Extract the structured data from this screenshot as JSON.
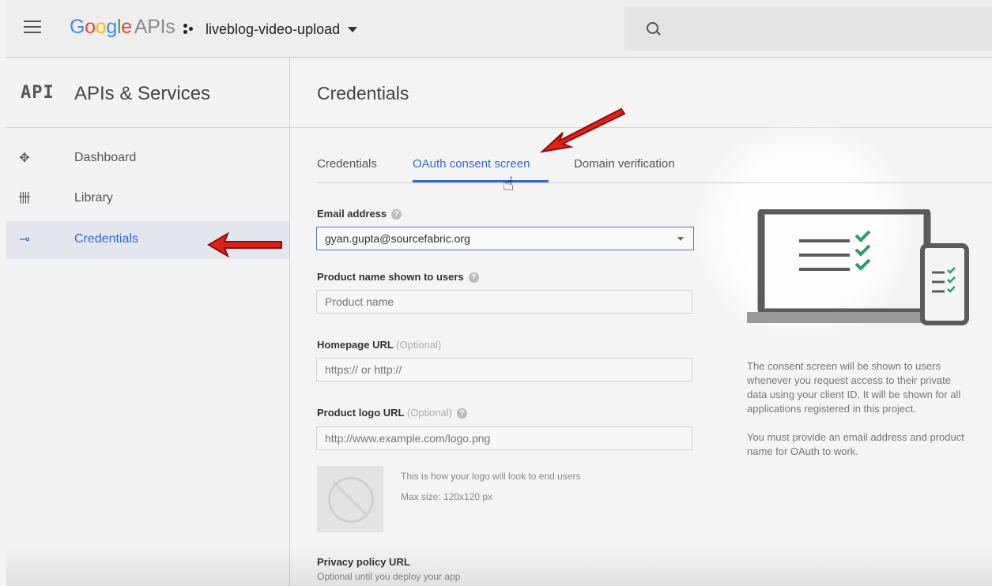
{
  "topbar": {
    "logo_google": [
      "G",
      "o",
      "o",
      "g",
      "l",
      "e"
    ],
    "logo_apis": "APIs",
    "project_name": "liveblog-video-upload"
  },
  "sidebar": {
    "api_logo": "API",
    "title": "APIs & Services",
    "items": [
      {
        "label": "Dashboard",
        "icon": "dashboard-icon"
      },
      {
        "label": "Library",
        "icon": "library-icon"
      },
      {
        "label": "Credentials",
        "icon": "key-icon",
        "active": true
      }
    ]
  },
  "main": {
    "title": "Credentials",
    "tabs": [
      {
        "label": "Credentials"
      },
      {
        "label": "OAuth consent screen",
        "active": true
      },
      {
        "label": "Domain verification"
      }
    ],
    "form": {
      "email_label": "Email address",
      "email_value": "gyan.gupta@sourcefabric.org",
      "product_name_label": "Product name shown to users",
      "product_name_placeholder": "Product name",
      "homepage_label": "Homepage URL",
      "homepage_optional": "(Optional)",
      "homepage_placeholder": "https:// or http://",
      "logo_label": "Product logo URL",
      "logo_optional": "(Optional)",
      "logo_placeholder": "http://www.example.com/logo.png",
      "logo_note": "This is how your logo will look to end users",
      "logo_max": "Max size: 120x120 px",
      "privacy_label": "Privacy policy URL",
      "privacy_sub": "Optional until you deploy your app"
    },
    "side": {
      "desc1": "The consent screen will be shown to users whenever you request access to their private data using your client ID. It will be shown for all applications registered in this project.",
      "desc2": "You must provide an email address and product name for OAuth to work."
    }
  },
  "colors": {
    "accent": "#3367d6",
    "arrow": "#e0201b"
  }
}
